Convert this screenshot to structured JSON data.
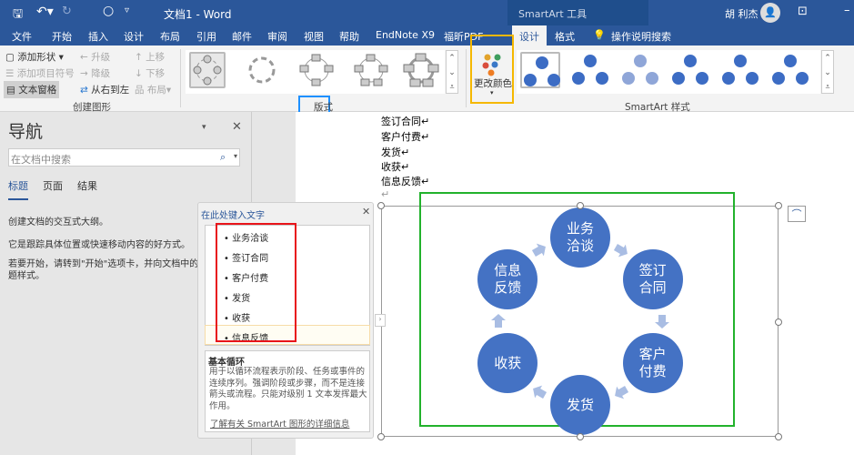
{
  "titlebar": {
    "title": "文档1 - Word",
    "context": "SmartArt 工具",
    "user": "胡 利杰"
  },
  "tabs": [
    {
      "label": "文件"
    },
    {
      "label": "开始"
    },
    {
      "label": "插入"
    },
    {
      "label": "设计"
    },
    {
      "label": "布局"
    },
    {
      "label": "引用"
    },
    {
      "label": "邮件"
    },
    {
      "label": "审阅"
    },
    {
      "label": "视图"
    },
    {
      "label": "帮助"
    },
    {
      "label": "EndNote X9"
    },
    {
      "label": "福昕PDF"
    },
    {
      "label": "设计"
    },
    {
      "label": "格式"
    },
    {
      "label": "操作说明搜索"
    }
  ],
  "ribbon": {
    "create": {
      "add_shape": "添加形状",
      "add_bullet": "添加项目符号",
      "text_pane": "文本窗格",
      "promote": "升级",
      "demote": "降级",
      "rtl": "从右到左",
      "move_up": "上移",
      "move_down": "下移",
      "layout": "布局",
      "group": "创建图形"
    },
    "layouts_group": "版式",
    "change_colors": "更改颜色",
    "styles_group": "SmartArt 样式",
    "accent": "#4472c4"
  },
  "nav": {
    "title": "导航",
    "search_placeholder": "在文档中搜索",
    "tabs": [
      "标题",
      "页面",
      "结果"
    ],
    "p1": "创建文档的交互式大纲。",
    "p2": "它是跟踪具体位置或快速移动内容的好方式。",
    "p3": "若要开始，请转到\"开始\"选项卡，并向文档中的标题应用标题样式。"
  },
  "document": {
    "lines": [
      "签订合同↵",
      "客户付费↵",
      "发货↵",
      "收获↵",
      "信息反馈↵",
      "↵"
    ]
  },
  "textpane": {
    "title": "在此处键入文字",
    "items": [
      "业务洽谈",
      "签订合同",
      "客户付费",
      "发货",
      "收获",
      "信息反馈"
    ],
    "desc_title": "基本循环",
    "desc": "用于以循环流程表示阶段、任务或事件的连续序列。强调阶段或步骤，而不是连接箭头或流程。只能对级别 1 文本发挥最大作用。",
    "link": "了解有关 SmartArt 图形的详细信息"
  },
  "diagram": {
    "nodes": [
      "业务\n洽谈",
      "签订\n合同",
      "客户\n付费",
      "发货",
      "收获",
      "信息\n反馈"
    ]
  }
}
